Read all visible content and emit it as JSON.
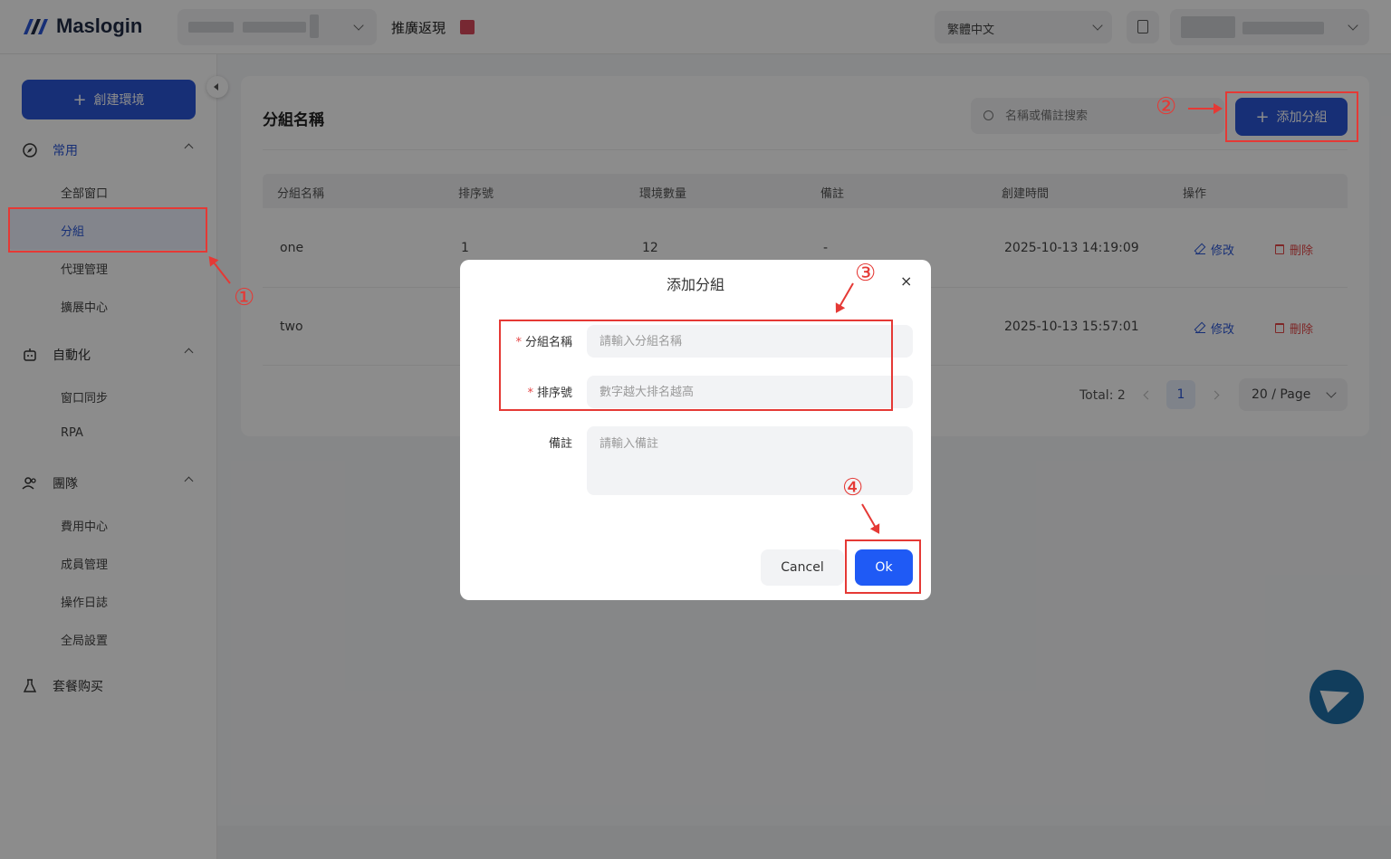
{
  "app": {
    "name": "Maslogin"
  },
  "topbar": {
    "promo_label": "推廣返現",
    "language": "繁體中文"
  },
  "sidebar": {
    "create_label": "創建環境",
    "groups": [
      {
        "label": "常用",
        "items": [
          "全部窗口",
          "分組",
          "代理管理",
          "擴展中心"
        ]
      },
      {
        "label": "自動化",
        "items": [
          "窗口同步",
          "RPA"
        ]
      },
      {
        "label": "團隊",
        "items": [
          "費用中心",
          "成員管理",
          "操作日誌",
          "全局設置"
        ]
      }
    ],
    "purchase_label": "套餐购买",
    "active_item": "分組"
  },
  "main": {
    "title": "分組名稱",
    "search_placeholder": "名稱或備註搜索",
    "add_label": "添加分組",
    "columns": [
      "分組名稱",
      "排序號",
      "環境數量",
      "備註",
      "創建時間",
      "操作"
    ],
    "rows": [
      {
        "name": "one",
        "order": "1",
        "count": "12",
        "note": "-",
        "created": "2025-10-13 14:19:09",
        "edit": "修改",
        "delete": "刪除"
      },
      {
        "name": "two",
        "order": "",
        "count": "",
        "note": "",
        "created": "2025-10-13 15:57:01",
        "edit": "修改",
        "delete": "刪除"
      }
    ],
    "pagination": {
      "total": "Total: 2",
      "current_page": "1",
      "page_size": "20 / Page"
    }
  },
  "modal": {
    "title": "添加分組",
    "close": "×",
    "fields": [
      {
        "label": "分組名稱",
        "required": true,
        "placeholder": "請輸入分組名稱"
      },
      {
        "label": "排序號",
        "required": true,
        "placeholder": "數字越大排名越高"
      },
      {
        "label": "備註",
        "required": false,
        "placeholder": "請輸入備註"
      }
    ],
    "cancel_label": "Cancel",
    "ok_label": "Ok"
  },
  "annotations": [
    "①",
    "②",
    "③",
    "④"
  ],
  "colors": {
    "primary": "#2b57d7",
    "ok_button": "#1f5af5",
    "annotation": "#e53935",
    "danger": "#e54848",
    "telegram": "#1f6fa8"
  },
  "icons": [
    "logo-icon",
    "chevron-down-icon",
    "gift-icon",
    "document-icon",
    "plus-icon",
    "collapse-icon",
    "compass-icon",
    "robot-icon",
    "team-icon",
    "flask-icon",
    "search-icon",
    "edit-icon",
    "trash-icon",
    "close-icon",
    "telegram-icon"
  ]
}
